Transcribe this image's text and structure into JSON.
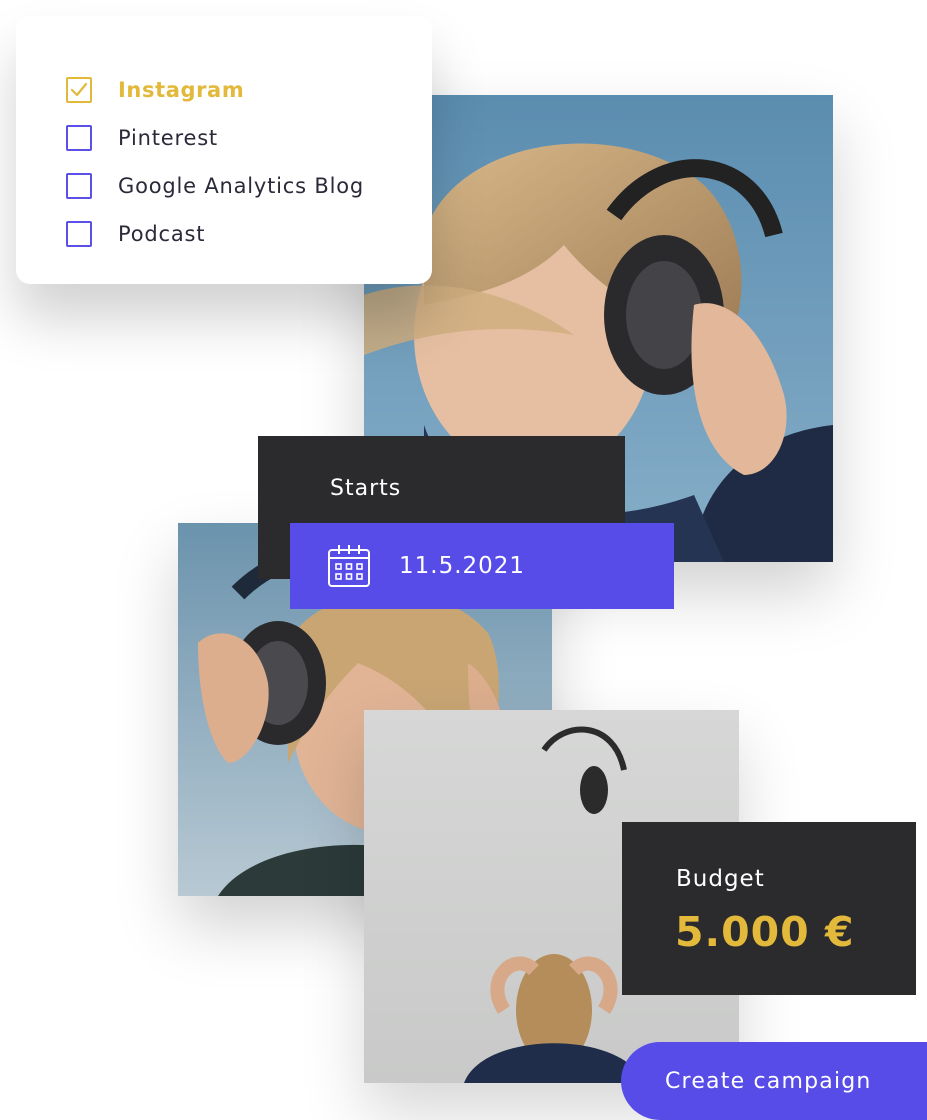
{
  "channels": {
    "items": [
      {
        "label": "Instagram",
        "checked": true
      },
      {
        "label": "Pinterest",
        "checked": false
      },
      {
        "label": "Google Analytics Blog",
        "checked": false
      },
      {
        "label": "Podcast",
        "checked": false
      }
    ]
  },
  "schedule": {
    "starts_label": "Starts",
    "date_value": "11.5.2021"
  },
  "budget": {
    "label": "Budget",
    "value": "5.000 €"
  },
  "actions": {
    "create_label": "Create campaign"
  },
  "colors": {
    "accent_purple": "#574ce8",
    "accent_gold": "#e2b93b",
    "card_dark": "#2b2b2e"
  },
  "icons": {
    "checkmark": "check-icon",
    "calendar": "calendar-icon"
  }
}
